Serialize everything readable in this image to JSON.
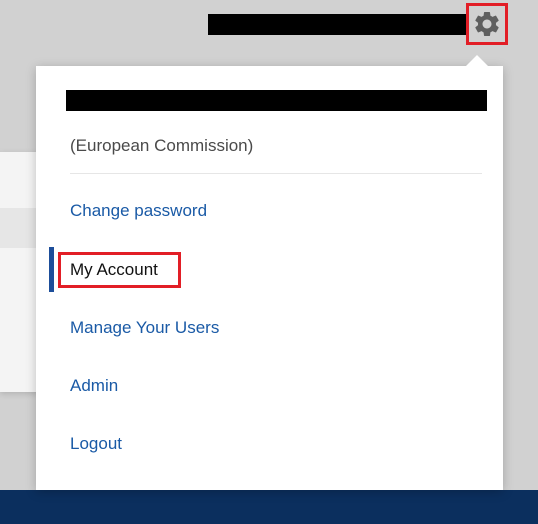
{
  "header": {
    "settings_icon": "gear-icon"
  },
  "user_menu": {
    "organisation": "(European Commission)",
    "items": [
      {
        "label": "Change password",
        "active": false
      },
      {
        "label": "My Account",
        "active": true
      },
      {
        "label": "Manage Your Users",
        "active": false
      },
      {
        "label": "Admin",
        "active": false
      },
      {
        "label": "Logout",
        "active": false
      }
    ]
  },
  "colors": {
    "link": "#1a5aa6",
    "active_text": "#111111",
    "active_indicator": "#1d4e9a",
    "highlight_border": "#e21e26",
    "footer_bar": "#0b2f5e"
  }
}
